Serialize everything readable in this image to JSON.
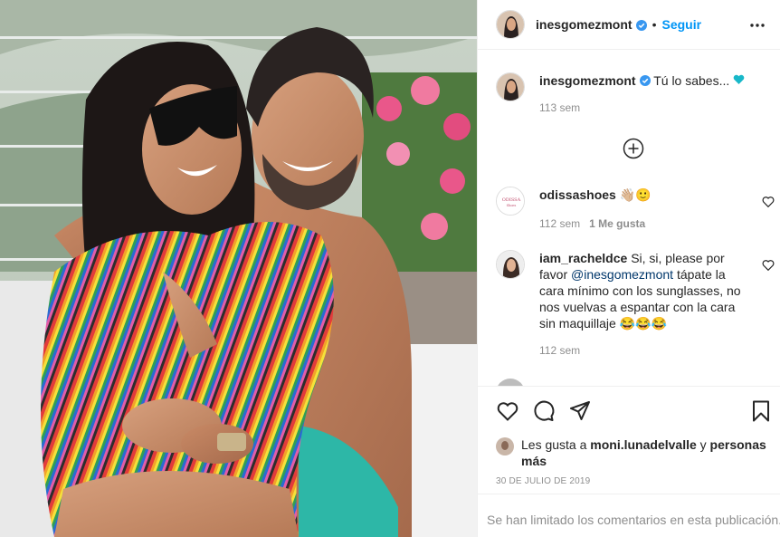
{
  "post": {
    "author": "inesgomezmont",
    "follow_label": "Seguir",
    "dot": "•",
    "caption": "Tú lo sabes...",
    "caption_time": "113 sem"
  },
  "comments": [
    {
      "user": "odissashoes",
      "emoji": "👋🏼🙂",
      "time": "112 sem",
      "likes": "1 Me gusta"
    },
    {
      "user": "iam_racheldce",
      "text_before": "Si, si, please por favor",
      "mention": "@inesgomezmont",
      "text_after": "tápate la cara mínimo con los sunglasses, no nos vuelvas a espantar con la cara sin maquillaje 😂😂😂",
      "time": "112 sem"
    }
  ],
  "likes": {
    "prefix": "Les gusta a",
    "user": "moni.lunadelvalle",
    "mid": "y",
    "suffix": "personas más"
  },
  "date": "30 DE JULIO DE 2019",
  "comments_limited": "Se han limitado los comentarios en esta publicación.",
  "colors": {
    "accent": "#0095f6",
    "verified": "#3897f0",
    "heart_emoji": "#18b8c9",
    "text": "#262626",
    "muted": "#8e8e8e"
  },
  "icons": {
    "more": "more-options-icon",
    "add": "add-circle-icon",
    "like": "heart-outline-icon",
    "comment": "comment-bubble-icon",
    "share": "paper-plane-icon",
    "save": "bookmark-icon"
  }
}
